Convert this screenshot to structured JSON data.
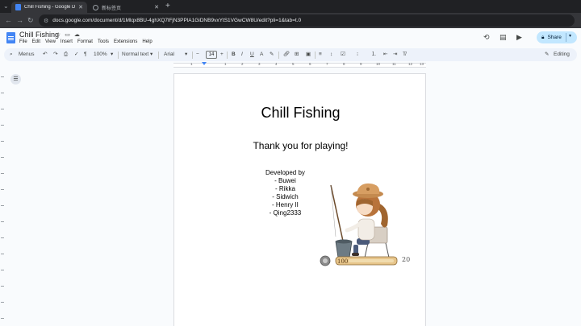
{
  "browser": {
    "tabs": [
      {
        "title": "Chill Fishing - Google Docs",
        "active": true
      },
      {
        "title": "新标签页",
        "active": false
      }
    ],
    "url": "docs.google.com/document/d/1Mlqx8BU-4ghXQ7lFjN3PPlA1GiDNB9vxYtS1VGwCW8U/edit?pli=1&tab=t.0"
  },
  "docs": {
    "title": "Chill Fishing",
    "menu": [
      "File",
      "Edit",
      "View",
      "Insert",
      "Format",
      "Tools",
      "Extensions",
      "Help"
    ],
    "share_label": "Share",
    "toolbar": {
      "menus_label": "Menus",
      "zoom": "100%",
      "style": "Normal text",
      "font": "Arial",
      "font_size": "14",
      "mode": "Editing"
    }
  },
  "ruler": [
    "1",
    "1",
    "2",
    "3",
    "4",
    "5",
    "6",
    "7",
    "8",
    "9",
    "10",
    "11",
    "12",
    "13"
  ],
  "document": {
    "heading": "Chill Fishing",
    "subheading": "Thank you for playing!",
    "credits": [
      "Developed by",
      "- Buwei",
      "- Rikka",
      "- Sidwich",
      "- Henry II",
      "- Qing2333"
    ],
    "hud_level": "100",
    "hud_count": "20"
  },
  "colors": {
    "accent": "#4285f4",
    "share_bg": "#c2e7ff",
    "toolbar_bg": "#edf2fa"
  }
}
